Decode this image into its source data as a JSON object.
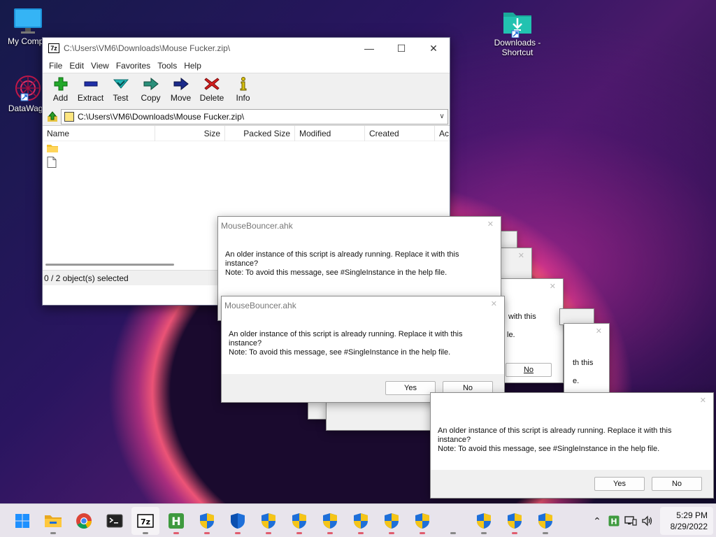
{
  "desktop": {
    "icons": [
      {
        "label": "My Compu",
        "icon": "monitor-icon"
      },
      {
        "label": "DataWago",
        "icon": "datawagon-icon"
      },
      {
        "label": "Downloads - Shortcut",
        "icon": "downloads-folder-icon"
      }
    ]
  },
  "sevenzip": {
    "title": "C:\\Users\\VM6\\Downloads\\Mouse Fucker.zip\\",
    "app_badge": "7z",
    "menu": [
      "File",
      "Edit",
      "View",
      "Favorites",
      "Tools",
      "Help"
    ],
    "toolbar": [
      {
        "label": "Add",
        "icon": "add-icon",
        "color": "#22a82a"
      },
      {
        "label": "Extract",
        "icon": "extract-icon",
        "color": "#1f2fa8"
      },
      {
        "label": "Test",
        "icon": "test-icon",
        "color": "#1fb5b5"
      },
      {
        "label": "Copy",
        "icon": "copy-icon",
        "color": "#2a8f7a"
      },
      {
        "label": "Move",
        "icon": "move-icon",
        "color": "#1a2a8a"
      },
      {
        "label": "Delete",
        "icon": "delete-icon",
        "color": "#d42020"
      },
      {
        "label": "Info",
        "icon": "info-icon",
        "color": "#d6c010"
      }
    ],
    "address": "C:\\Users\\VM6\\Downloads\\Mouse Fucker.zip\\",
    "columns": [
      "Name",
      "Size",
      "Packed Size",
      "Modified",
      "Created",
      "Ac"
    ],
    "status": "0 / 2 object(s) selected"
  },
  "dialogs": {
    "title": "MouseBouncer.ahk",
    "line1": "An older instance of this script is already running.  Replace it with this",
    "line2": "instance?",
    "line3": "Note: To avoid this message, see #SingleInstance in the help file.",
    "partial_line": "th this",
    "yes": "Yes",
    "no": "No"
  },
  "taskbar": {
    "clock_time": "5:29 PM",
    "clock_date": "8/29/2022",
    "tray_badge": "H"
  },
  "colors": {
    "accent_blue": "#0078d4",
    "taskbar_bg": "#e8e4ec",
    "shield_blue": "#1e6fd9",
    "shield_yellow": "#f5c518"
  }
}
